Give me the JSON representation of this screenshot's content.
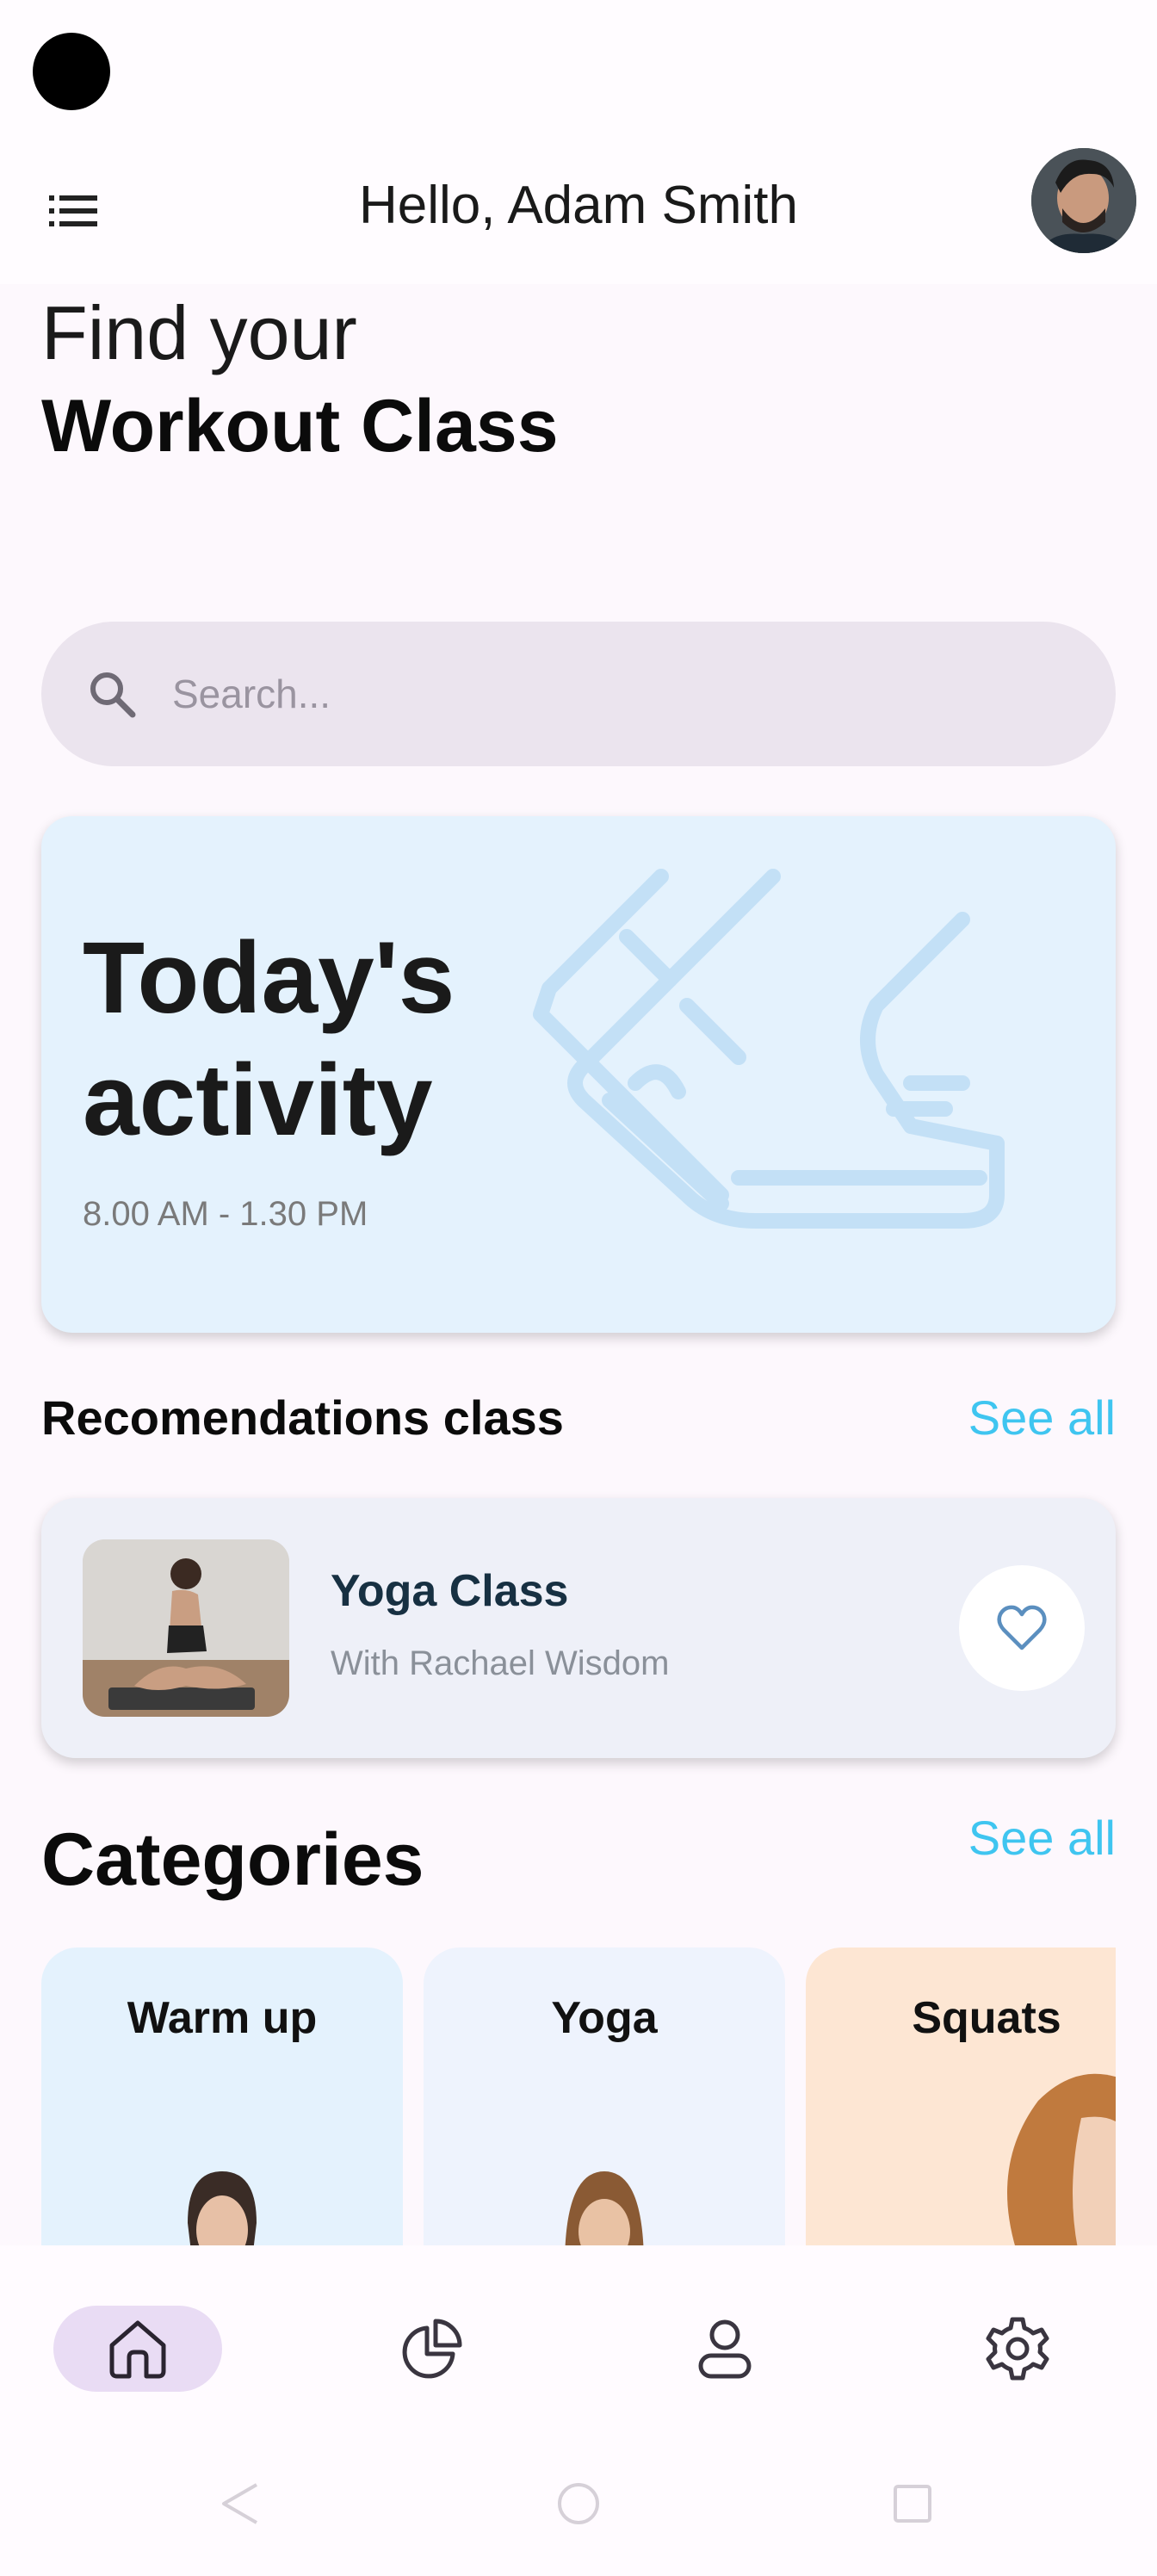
{
  "header": {
    "greeting": "Hello, Adam Smith",
    "menu_icon": "list-menu-icon",
    "avatar_icon": "user-avatar"
  },
  "hero": {
    "line1": "Find your",
    "line2": "Workout Class"
  },
  "search": {
    "placeholder": "Search...",
    "icon": "search-icon"
  },
  "activity": {
    "title": "Today's activity",
    "time": "8.00 AM - 1.30 PM",
    "illustration": "running-shoes-icon",
    "background": "#e4f2fd"
  },
  "recommendations": {
    "title": "Recomendations class",
    "see_all": "See all",
    "item": {
      "title": "Yoga Class",
      "subtitle": "With Rachael Wisdom",
      "favorite_icon": "heart-icon"
    }
  },
  "categories": {
    "title": "Categories",
    "see_all": "See all",
    "items": [
      {
        "label": "Warm up",
        "color": "#e4f2fd"
      },
      {
        "label": "Yoga",
        "color": "#eef3fd"
      },
      {
        "label": "Squats",
        "color": "#fde6d3"
      }
    ]
  },
  "bottom_nav": {
    "items": [
      {
        "icon": "home-icon",
        "active": true
      },
      {
        "icon": "pie-chart-icon",
        "active": false
      },
      {
        "icon": "profile-icon",
        "active": false
      },
      {
        "icon": "settings-icon",
        "active": false
      }
    ]
  },
  "colors": {
    "accent_link": "#3fc5f0",
    "nav_active_pill": "#e9dcf4",
    "page_background": "#fdf8fd"
  }
}
